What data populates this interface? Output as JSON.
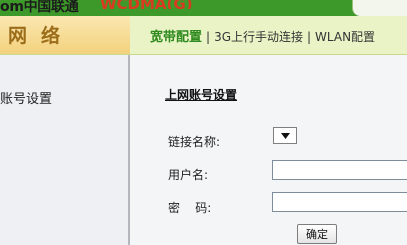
{
  "header": {
    "brand_text": "om中国联通",
    "banner_text": "WCDMA(G)",
    "colors": {
      "top_bar": "#3d9a2a",
      "banner": "#d93b20"
    }
  },
  "section": {
    "title": "网络",
    "nav": [
      {
        "label": "宽带配置",
        "active": true
      },
      {
        "label": "3G上行手动连接",
        "active": false
      },
      {
        "label": "WLAN配置",
        "active": false
      }
    ],
    "separator": "|"
  },
  "sidebar": {
    "items": [
      {
        "label": "账号设置"
      }
    ]
  },
  "form": {
    "title": "上网账号设置",
    "connection_name_label": "链接名称:",
    "connection_name_value": "",
    "username_label": "用户名:",
    "username_value": "",
    "password_label": "密    码:",
    "password_value": "",
    "confirm_label": "确定"
  },
  "icons": {
    "dropdown": "chevron-down-icon"
  }
}
